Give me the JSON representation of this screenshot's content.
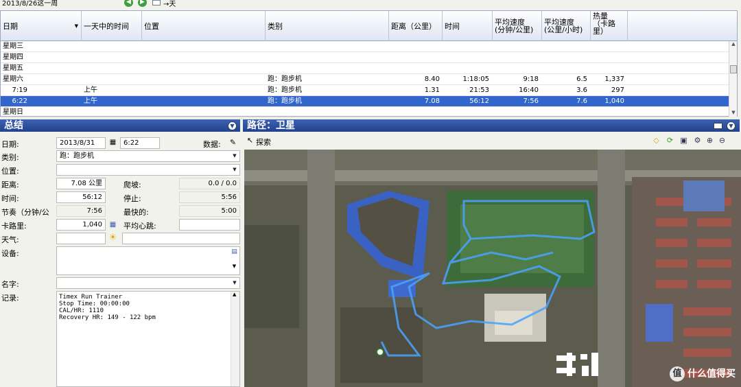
{
  "week_label": "2013/8/26这一周",
  "week_nav_next": "→天",
  "columns": [
    "日期",
    "一天中的时间",
    "位置",
    "类别",
    "距离（公里）",
    "时间",
    "平均速度（分钟/公里）",
    "平均速度（公里/小时）",
    "热量（卡路里）"
  ],
  "column_lines": {
    "pace": [
      "平均速度",
      "(分钟/公里)"
    ],
    "speed": [
      "平均速度",
      "(公里/小时)"
    ],
    "calories": [
      "热量",
      "（卡路",
      "里）"
    ]
  },
  "rows": [
    {
      "date": "星期三",
      "tod": "",
      "location": "",
      "category": "",
      "distance": "",
      "time": "",
      "pace": "",
      "speed": "",
      "calories": "",
      "selected": false,
      "indent": false
    },
    {
      "date": "星期四",
      "tod": "",
      "location": "",
      "category": "",
      "distance": "",
      "time": "",
      "pace": "",
      "speed": "",
      "calories": "",
      "selected": false,
      "indent": false
    },
    {
      "date": "星期五",
      "tod": "",
      "location": "",
      "category": "",
      "distance": "",
      "time": "",
      "pace": "",
      "speed": "",
      "calories": "",
      "selected": false,
      "indent": false
    },
    {
      "date": "星期六",
      "tod": "",
      "location": "",
      "category": "跑：跑步机",
      "distance": "8.40",
      "time": "1:18:05",
      "pace": "9:18",
      "speed": "6.5",
      "calories": "1,337",
      "selected": false,
      "indent": false
    },
    {
      "date": "7:19",
      "tod": "上午",
      "location": "",
      "category": "跑：跑步机",
      "distance": "1.31",
      "time": "21:53",
      "pace": "16:40",
      "speed": "3.6",
      "calories": "297",
      "selected": false,
      "indent": true
    },
    {
      "date": "6:22",
      "tod": "上午",
      "location": "",
      "category": "跑：跑步机",
      "distance": "7.08",
      "time": "56:12",
      "pace": "7:56",
      "speed": "7.6",
      "calories": "1,040",
      "selected": true,
      "indent": true
    },
    {
      "date": "星期日",
      "tod": "",
      "location": "",
      "category": "",
      "distance": "",
      "time": "",
      "pace": "",
      "speed": "",
      "calories": "",
      "selected": false,
      "indent": false
    }
  ],
  "summary": {
    "title": "总结",
    "date_label": "日期:",
    "date_value": "2013/8/31",
    "time_value": "6:22",
    "data_label": "数据:",
    "category_label": "类别:",
    "category_value": "跑：跑步机",
    "location_label": "位置:",
    "location_value": "",
    "distance_label": "距离:",
    "distance_value": "7.08 公里",
    "climb_label": "爬坡:",
    "climb_value": "0.0 / 0.0",
    "time_label": "时间:",
    "time_dur_value": "56:12",
    "stop_label": "停止:",
    "stop_value": "5:56",
    "pace_label": "节奏（分钟/公",
    "pace_value": "7:56",
    "fastest_label": "最快的:",
    "fastest_value": "5:00",
    "calories_label": "卡路里:",
    "calories_value": "1,040",
    "avg_hr_label": "平均心跳:",
    "avg_hr_value": "",
    "weather_label": "天气:",
    "weather_value": "",
    "equipment_label": "设备:",
    "name_label": "名字:",
    "name_value": "",
    "notes_label": "记录:",
    "notes_value": "Timex Run Trainer\nStop Time: 00:00:00\nCAL/HR: 1110\nRecovery HR: 149 - 122 bpm"
  },
  "route": {
    "title": "路径：卫星",
    "explore_label": "探索"
  },
  "watermark": "值 什么值得买",
  "watermark_icon": "值",
  "watermark_text": "什么值得买",
  "colors": {
    "selection": "#3366cc",
    "panel_header": "#2c4c9c",
    "route": "#4aa3ff",
    "grass": "#2e8a2e"
  }
}
